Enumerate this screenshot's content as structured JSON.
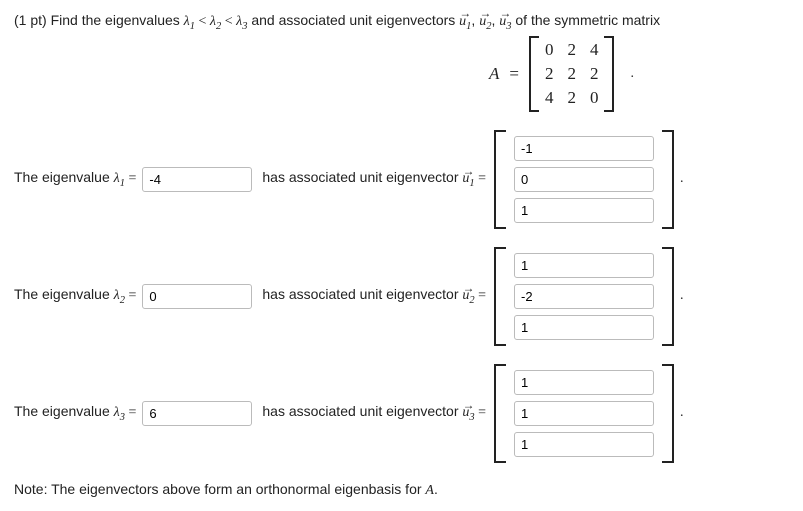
{
  "points_prefix": "(1 pt) ",
  "prompt_a": "Find the eigenvalues ",
  "lam": "λ",
  "lt": " < ",
  "prompt_b": " and associated unit eigenvectors ",
  "uvec": "u",
  "comma": ", ",
  "prompt_c": " of the symmetric matrix",
  "A_label": "A",
  "equals": " = ",
  "matrix": [
    [
      "0",
      "2",
      "4"
    ],
    [
      "2",
      "2",
      "2"
    ],
    [
      "4",
      "2",
      "0"
    ]
  ],
  "period": ".",
  "row_pre": "The eigenvalue ",
  "row_mid": "has associated unit eigenvector ",
  "eig": [
    {
      "val": "-4",
      "vec": [
        "-1",
        "0",
        "1"
      ]
    },
    {
      "val": "0",
      "vec": [
        "1",
        "-2",
        "1"
      ]
    },
    {
      "val": "6",
      "vec": [
        "1",
        "1",
        "1"
      ]
    }
  ],
  "note_a": "Note: The eigenvectors above form an orthonormal eigenbasis for ",
  "note_b": "."
}
